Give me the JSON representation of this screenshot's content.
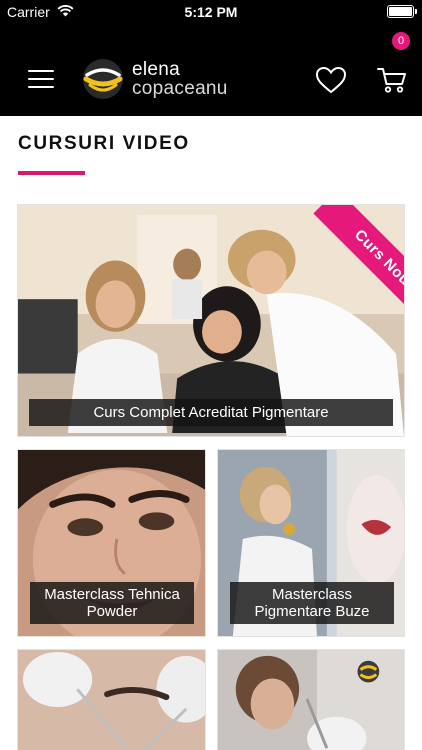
{
  "status_bar": {
    "carrier": "Carrier",
    "time": "5:12 PM"
  },
  "header": {
    "logo_line1": "elena",
    "logo_line2": "copaceanu",
    "cart_count": "0"
  },
  "section": {
    "title": "CURSURI VIDEO"
  },
  "courses": [
    {
      "title": "Curs Complet Acreditat Pigmentare",
      "badge": "Curs Nou"
    },
    {
      "title": "Masterclass Tehnica Powder"
    },
    {
      "title": "Masterclass Pigmentare Buze"
    },
    {
      "title": ""
    },
    {
      "title": ""
    }
  ],
  "colors": {
    "accent": "#e4197a",
    "header_bg": "#000000"
  },
  "icons": [
    "wifi-icon",
    "battery-icon",
    "hamburger-menu-icon",
    "brand-logo-icon",
    "heart-icon",
    "cart-icon"
  ]
}
